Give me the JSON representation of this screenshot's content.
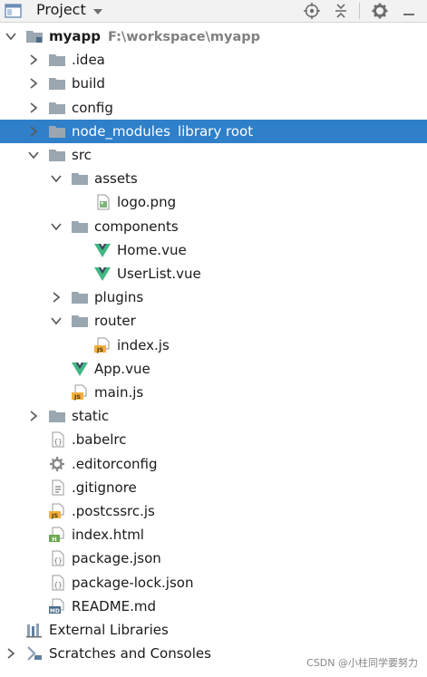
{
  "header": {
    "title": "Project",
    "icon": "project-panel-icon",
    "tools": [
      "locate-icon",
      "collapse-all-icon",
      "settings-icon",
      "hide-icon"
    ]
  },
  "tree": {
    "root": {
      "name": "myapp",
      "path": "F:\\workspace\\myapp"
    },
    "items": [
      {
        "label": ".idea"
      },
      {
        "label": "build"
      },
      {
        "label": "config"
      },
      {
        "label": "node_modules",
        "extra": "library root"
      },
      {
        "label": "src"
      },
      {
        "label": "assets"
      },
      {
        "label": "logo.png"
      },
      {
        "label": "components"
      },
      {
        "label": "Home.vue"
      },
      {
        "label": "UserList.vue"
      },
      {
        "label": "plugins"
      },
      {
        "label": "router"
      },
      {
        "label": "index.js"
      },
      {
        "label": "App.vue"
      },
      {
        "label": "main.js"
      },
      {
        "label": "static"
      },
      {
        "label": ".babelrc"
      },
      {
        "label": ".editorconfig"
      },
      {
        "label": ".gitignore"
      },
      {
        "label": ".postcssrc.js"
      },
      {
        "label": "index.html"
      },
      {
        "label": "package.json"
      },
      {
        "label": "package-lock.json"
      },
      {
        "label": "README.md"
      },
      {
        "label": "External Libraries"
      },
      {
        "label": "Scratches and Consoles"
      }
    ]
  },
  "colors": {
    "selection": "#2f7fc9",
    "folder": "#9aa7b0",
    "vue_green": "#41b883",
    "vue_dark": "#35495e",
    "js_yellow": "#f4af3d"
  },
  "watermark": "CSDN @小柱同学要努力"
}
